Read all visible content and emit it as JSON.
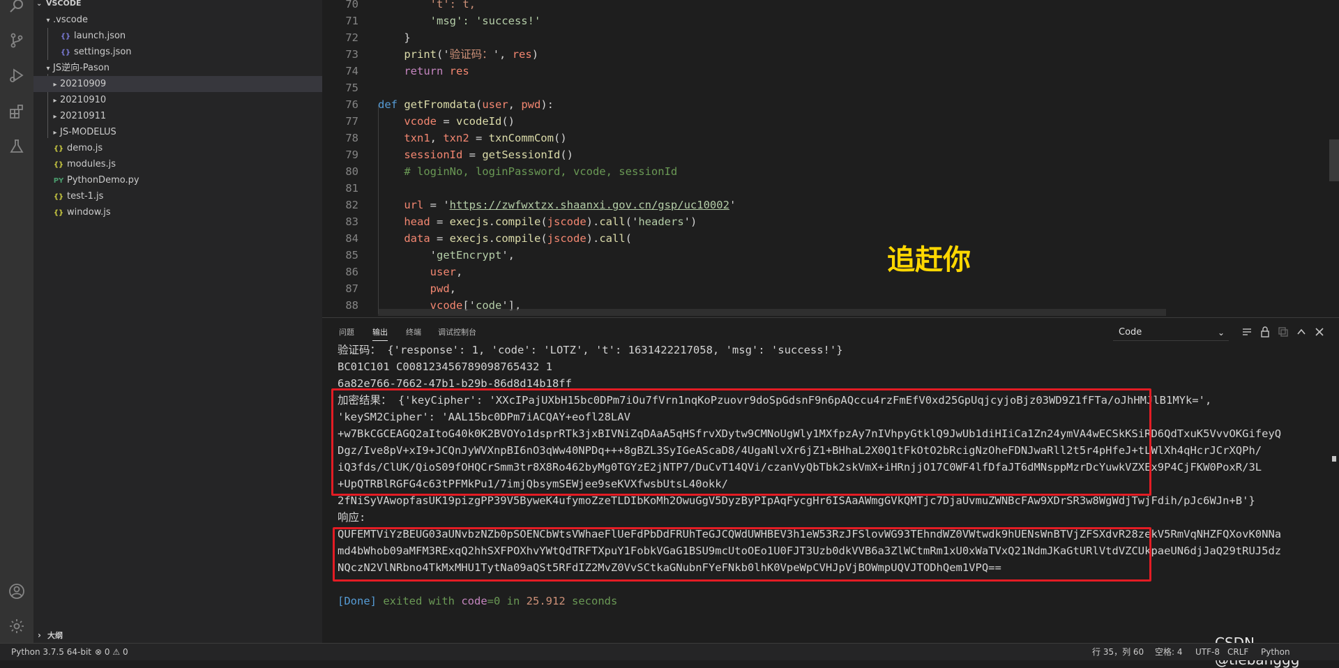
{
  "explorer": {
    "title": "VSCODE",
    "items": [
      {
        "label": ".vscode",
        "type": "folder-open"
      },
      {
        "label": "launch.json",
        "type": "json"
      },
      {
        "label": "settings.json",
        "type": "json"
      },
      {
        "label": "JS逆向-Pason",
        "type": "folder-open"
      },
      {
        "label": "20210909",
        "type": "folder"
      },
      {
        "label": "20210910",
        "type": "folder"
      },
      {
        "label": "20210911",
        "type": "folder"
      },
      {
        "label": "JS-MODELUS",
        "type": "folder"
      },
      {
        "label": "demo.js",
        "type": "js"
      },
      {
        "label": "modules.js",
        "type": "js"
      },
      {
        "label": "PythonDemo.py",
        "type": "py"
      },
      {
        "label": "test-1.js",
        "type": "js"
      },
      {
        "label": "window.js",
        "type": "js"
      }
    ],
    "outline_label": "大纲",
    "icon_glyphs": {
      "js": "{}",
      "json": "{}",
      "py": "PY"
    }
  },
  "editor": {
    "line_numbers": [
      "70",
      "71",
      "72",
      "73",
      "74",
      "75",
      "76",
      "77",
      "78",
      "79",
      "80",
      "81",
      "82",
      "83",
      "84",
      "85",
      "86",
      "87",
      "88"
    ],
    "lines": [
      [
        {
          "t": "        't': t,",
          "c": "str"
        }
      ],
      [
        {
          "t": "        'msg': 'success!'",
          "c": "strg"
        }
      ],
      [
        {
          "t": "    }",
          "c": ""
        }
      ],
      [
        {
          "t": "    ",
          "c": ""
        },
        {
          "t": "print",
          "c": "fn"
        },
        {
          "t": "('",
          "c": ""
        },
        {
          "t": "验证码：",
          "c": "str"
        },
        {
          "t": "', ",
          "c": ""
        },
        {
          "t": "res",
          "c": "var2"
        },
        {
          "t": ")",
          "c": ""
        }
      ],
      [
        {
          "t": "    ",
          "c": ""
        },
        {
          "t": "return",
          "c": "kw2"
        },
        {
          "t": " ",
          "c": ""
        },
        {
          "t": "res",
          "c": "var2"
        }
      ],
      [
        {
          "t": "",
          "c": ""
        }
      ],
      [
        {
          "t": "def",
          "c": "kw"
        },
        {
          "t": " ",
          "c": ""
        },
        {
          "t": "getFromdata",
          "c": "fn"
        },
        {
          "t": "(",
          "c": ""
        },
        {
          "t": "user",
          "c": "var2"
        },
        {
          "t": ", ",
          "c": ""
        },
        {
          "t": "pwd",
          "c": "var2"
        },
        {
          "t": "):",
          "c": ""
        }
      ],
      [
        {
          "t": "    ",
          "c": ""
        },
        {
          "t": "vcode",
          "c": "var2"
        },
        {
          "t": " = ",
          "c": ""
        },
        {
          "t": "vcodeId",
          "c": "fn"
        },
        {
          "t": "()",
          "c": ""
        }
      ],
      [
        {
          "t": "    ",
          "c": ""
        },
        {
          "t": "txn1",
          "c": "var2"
        },
        {
          "t": ", ",
          "c": ""
        },
        {
          "t": "txn2",
          "c": "var2"
        },
        {
          "t": " = ",
          "c": ""
        },
        {
          "t": "txnCommCom",
          "c": "fn"
        },
        {
          "t": "()",
          "c": ""
        }
      ],
      [
        {
          "t": "    ",
          "c": ""
        },
        {
          "t": "sessionId",
          "c": "var2"
        },
        {
          "t": " = ",
          "c": ""
        },
        {
          "t": "getSessionId",
          "c": "fn"
        },
        {
          "t": "()",
          "c": ""
        }
      ],
      [
        {
          "t": "    # loginNo, loginPassword, vcode, sessionId",
          "c": "cm"
        }
      ],
      [
        {
          "t": "",
          "c": ""
        }
      ],
      [
        {
          "t": "    ",
          "c": ""
        },
        {
          "t": "url",
          "c": "var2"
        },
        {
          "t": " = '",
          "c": ""
        },
        {
          "t": "https://zwfwxtzx.shaanxi.gov.cn/gsp/uc10002",
          "c": "strg"
        },
        {
          "t": "'",
          "c": ""
        }
      ],
      [
        {
          "t": "    ",
          "c": ""
        },
        {
          "t": "head",
          "c": "var2"
        },
        {
          "t": " = ",
          "c": ""
        },
        {
          "t": "execjs",
          "c": "fn"
        },
        {
          "t": ".",
          "c": ""
        },
        {
          "t": "compile",
          "c": "fn"
        },
        {
          "t": "(",
          "c": ""
        },
        {
          "t": "jscode",
          "c": "var2"
        },
        {
          "t": ").",
          "c": ""
        },
        {
          "t": "call",
          "c": "fn"
        },
        {
          "t": "('",
          "c": ""
        },
        {
          "t": "headers",
          "c": "strg"
        },
        {
          "t": "')",
          "c": ""
        }
      ],
      [
        {
          "t": "    ",
          "c": ""
        },
        {
          "t": "data",
          "c": "var2"
        },
        {
          "t": " = ",
          "c": ""
        },
        {
          "t": "execjs",
          "c": "fn"
        },
        {
          "t": ".",
          "c": ""
        },
        {
          "t": "compile",
          "c": "fn"
        },
        {
          "t": "(",
          "c": ""
        },
        {
          "t": "jscode",
          "c": "var2"
        },
        {
          "t": ").",
          "c": ""
        },
        {
          "t": "call",
          "c": "fn"
        },
        {
          "t": "(",
          "c": ""
        }
      ],
      [
        {
          "t": "        '",
          "c": ""
        },
        {
          "t": "getEncrypt",
          "c": "strg"
        },
        {
          "t": "',",
          "c": ""
        }
      ],
      [
        {
          "t": "        ",
          "c": ""
        },
        {
          "t": "user",
          "c": "var2"
        },
        {
          "t": ",",
          "c": ""
        }
      ],
      [
        {
          "t": "        ",
          "c": ""
        },
        {
          "t": "pwd",
          "c": "var2"
        },
        {
          "t": ",",
          "c": ""
        }
      ],
      [
        {
          "t": "        ",
          "c": ""
        },
        {
          "t": "vcode",
          "c": "var2"
        },
        {
          "t": "['",
          "c": ""
        },
        {
          "t": "code",
          "c": "strg"
        },
        {
          "t": "'],",
          "c": ""
        }
      ]
    ]
  },
  "panel": {
    "tabs": [
      "问题",
      "输出",
      "终端",
      "调试控制台"
    ],
    "active_tab": "输出",
    "dropdown_value": "Code",
    "output_lines": [
      "验证码： {'response': 1, 'code': 'LOTZ', 't': 1631422217058, 'msg': 'success!'}",
      "BC01C101 C008123456789098765432 1",
      "6a82e766-7662-47b1-b29b-86d8d14b18ff",
      "加密结果： {'keyCipher': 'XXcIPajUXbH15bc0DPm7iOu7fVrn1nqKoPzuovr9doSpGdsnF9n6pAQccu4rzFmEfV0xd25GpUqjcyjoBjz03WD9Z1fFTa/oJhHMJlB1MYk=',",
      "'keySM2Cipher': 'AAL15bc0DPm7iACQAY+eofl28LAV",
      "+w7BkCGCEAGQ2aItoG40k0K2BVOYo1dsprRTk3jxBIVNiZqDAaA5qHSfrvXDytw9CMNoUgWly1MXfpzAy7nIVhpyGtklQ9JwUb1diHIiCa1Zn24ymVA4wECSkKSiRD6QdTxuK5VvvOKGifeyQ",
      "Dgz/Ive8pV+xI9+JCQnJyWVXnpBI6nO3qWw40NPDq+++8gBZL3SyIGeAScaD8/4UgaNlvXr6jZ1+BHhaL2X0Q1tFkOtO2bRcigNzOheFDNJwaRll2t5r4pHfeJ+tLWlXh4qHcrJCrXQPh/",
      "iQ3fds/ClUK/QioS09fOHQCrSmm3tr8X8Ro462byMg0TGYzE2jNTP7/DuCvT14QVi/czanVyQbTbk2skVmX+iHRnjjO17C0WF4lfDfaJT6dMNsppMzrDcYuwkVZXEx9P4CjFKW0PoxR/3L",
      "+UpQTRBlRGFG4c63tPFMkPu1/7imjQbsymSEWjee9seKVXfwsbUtsL40okk/",
      "2fNiSyVAwopfasUK19pizgPP39V5ByweK4ufymoZzeTLDIbKoMh2OwuGgV5DyzByPIpAqFycgHr6ISAaAWmgGVkQMTjc7DjaUvmuZWNBcFAw9XDrSR3w8WgWdjTwjFdih/pJc6WJn+B'}",
      "响应:",
      "QUFEMTViYzBEUG03aUNvbzNZb0pSOENCbWtsVWhaeFlUeFdPbDdFRUhTeGJCQWdUWHBEV3h1eW53RzJFSlovWG93TEhndWZ0VWtwdk9hUENsWnBTVjZFSXdvR28zekV5RmVqNHZFQXovK0NNa",
      "md4bWhob09aMFM3RExqQ2hhSXFPOXhvYWtQdTRFTXpuY1FobkVGaG1BSU9mcUtoOEo1U0FJT3Uzb0dkVVB6a3ZlWCtmRm1xU0xWaTVxQ21NdmJKaGtURlVtdVZCUkpaeUN6djJaQ29tRUJ5dz",
      "NQczN2VlNRbno4TkMxMHU1TytNa09aQSt5RFdIZ2MvZ0VvSCtkaGNubnFYeFNkb0lhK0VpeWpCVHJpVjBOWmpUQVJTODhQem1VPQ==",
      "",
      "[Done] exited with code=0 in 25.912 seconds"
    ],
    "done_parts": {
      "prefix": "[Done]",
      "mid1": " exited with ",
      "code_label": "code",
      "eq": "=0 in ",
      "time": "25.912",
      "suffix": " seconds"
    }
  },
  "overlay": {
    "watermark_text": "追赶你",
    "csdn_text": "CSDN @tiebanggg"
  },
  "statusbar": {
    "python_version": "Python 3.7.5 64-bit",
    "errors": "0",
    "warnings": "0",
    "position": "行 35，列 60",
    "spaces": "空格: 4",
    "encoding": "UTF-8",
    "eol": "CRLF",
    "language": "Python"
  },
  "colors": {
    "highlight_box": "#e31c24",
    "watermark": "#ffd700",
    "done_blue": "#569cd6",
    "done_green": "#6a9955"
  }
}
